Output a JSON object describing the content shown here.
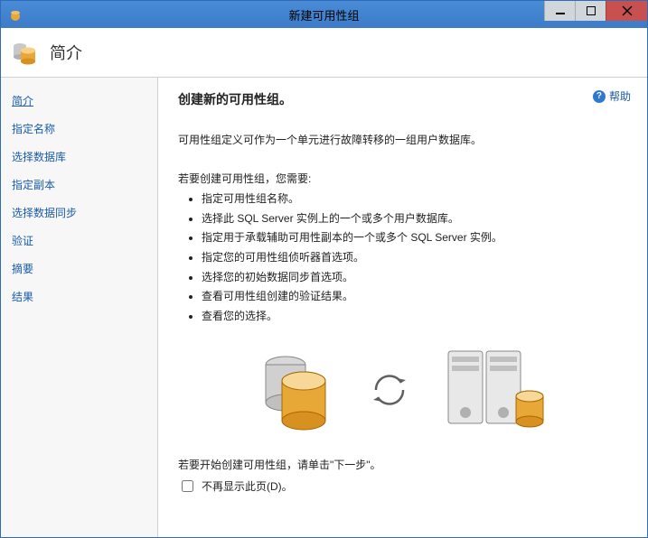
{
  "titlebar": {
    "title": "新建可用性组"
  },
  "header": {
    "title": "简介"
  },
  "sidebar": {
    "items": [
      {
        "label": "简介",
        "active": true
      },
      {
        "label": "指定名称"
      },
      {
        "label": "选择数据库"
      },
      {
        "label": "指定副本"
      },
      {
        "label": "选择数据同步"
      },
      {
        "label": "验证"
      },
      {
        "label": "摘要"
      },
      {
        "label": "结果"
      }
    ]
  },
  "content": {
    "help": "帮助",
    "section_title": "创建新的可用性组。",
    "description": "可用性组定义可作为一个单元进行故障转移的一组用户数据库。",
    "need_label": "若要创建可用性组，您需要:",
    "bullets": [
      "指定可用性组名称。",
      "选择此 SQL Server 实例上的一个或多个用户数据库。",
      "指定用于承载辅助可用性副本的一个或多个 SQL Server 实例。",
      "指定您的可用性组侦听器首选项。",
      "选择您的初始数据同步首选项。",
      "查看可用性组创建的验证结果。",
      "查看您的选择。"
    ],
    "start_text": "若要开始创建可用性组，请单击\"下一步\"。",
    "checkbox_label": "不再显示此页(D)。"
  }
}
